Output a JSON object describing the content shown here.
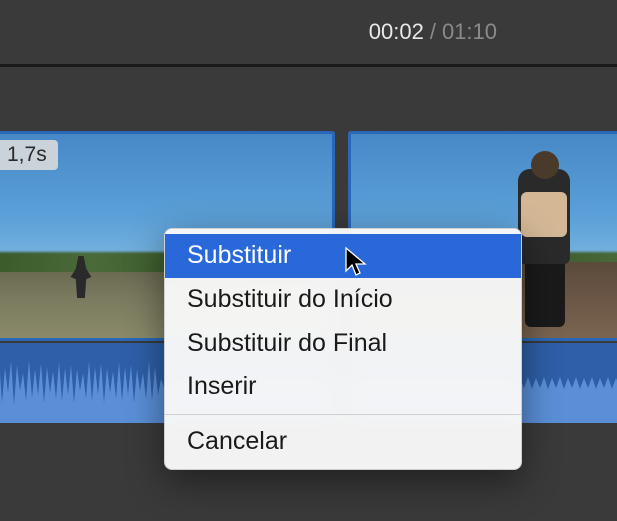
{
  "header": {
    "time_current": "00:02",
    "time_separator": "/",
    "time_total": "01:10"
  },
  "clips": {
    "left": {
      "duration_badge": "1,7s"
    }
  },
  "menu": {
    "items": [
      {
        "label": "Substituir",
        "highlighted": true
      },
      {
        "label": "Substituir do Início",
        "highlighted": false
      },
      {
        "label": "Substituir do Final",
        "highlighted": false
      },
      {
        "label": "Inserir",
        "highlighted": false
      }
    ],
    "cancel_label": "Cancelar"
  },
  "colors": {
    "highlight": "#2968d8",
    "background": "#3a3a3a",
    "clip_border": "#2968b8"
  }
}
